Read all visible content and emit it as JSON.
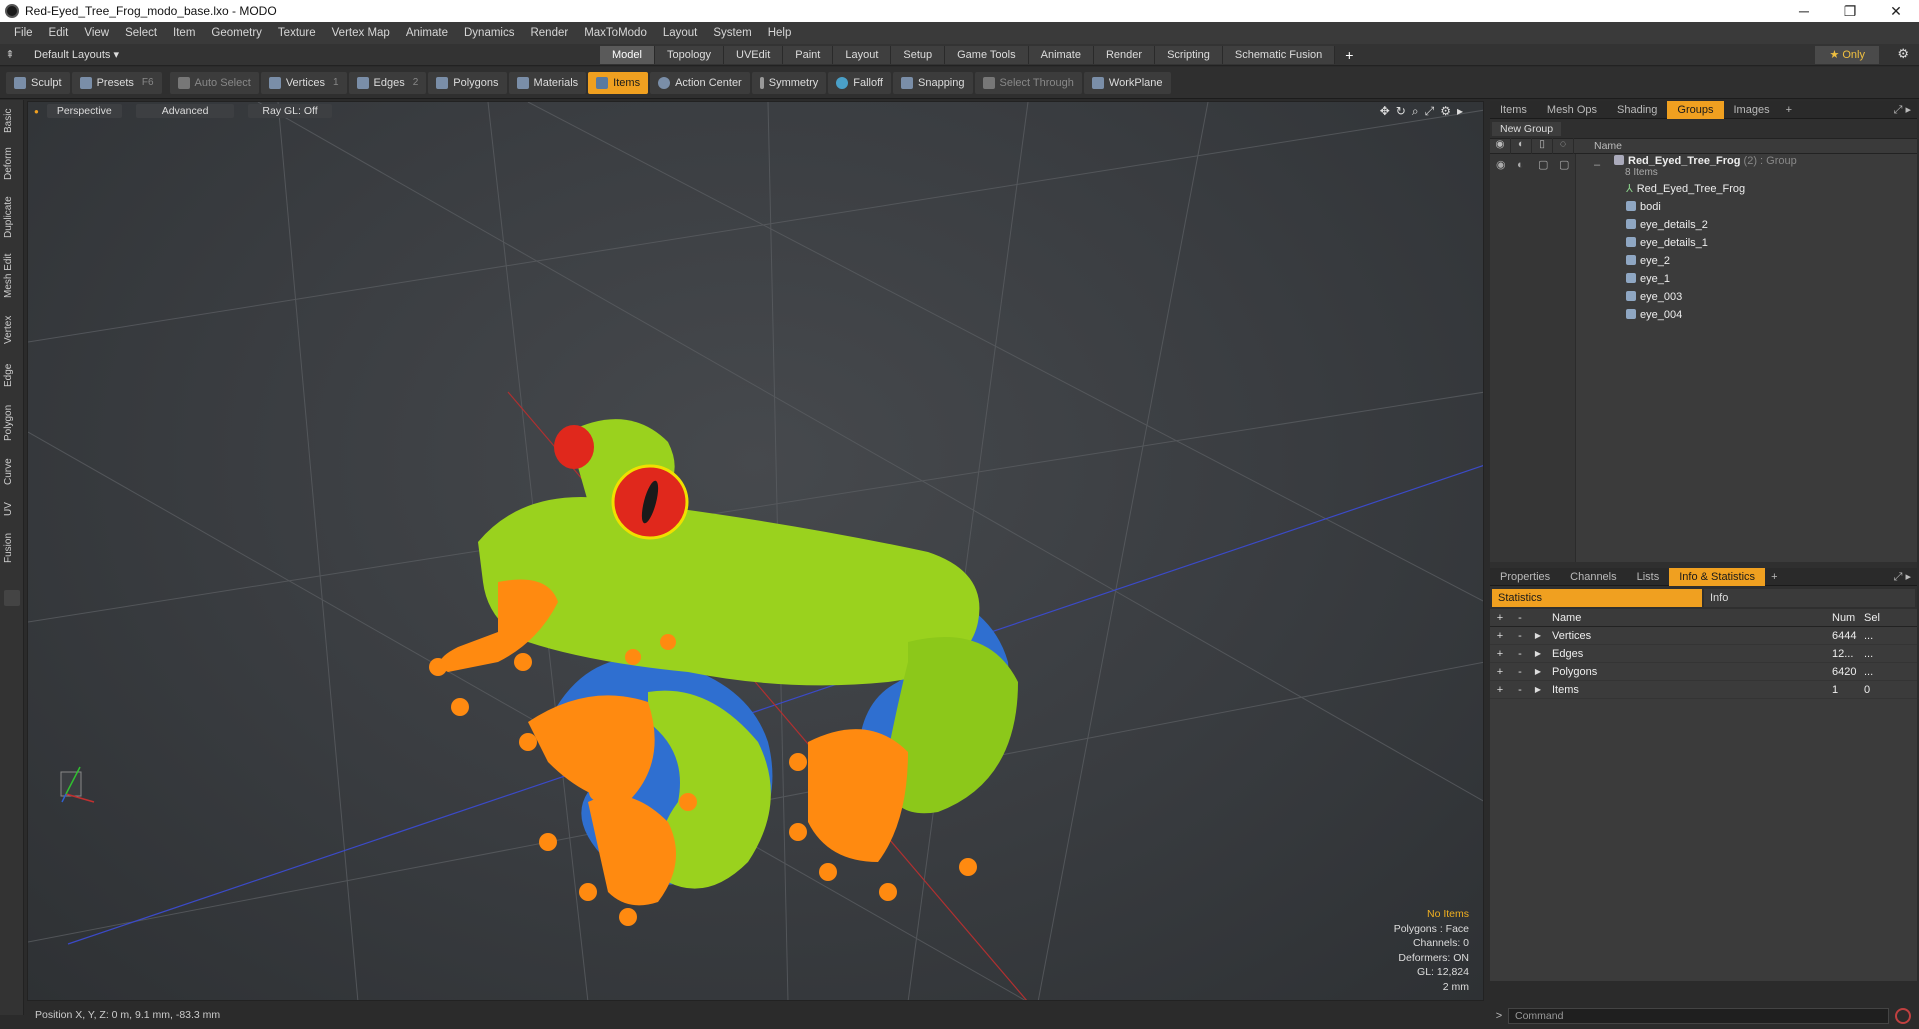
{
  "window": {
    "title": "Red-Eyed_Tree_Frog_modo_base.lxo - MODO",
    "minimize": "─",
    "maximize": "❐",
    "close": "✕"
  },
  "menu": [
    "File",
    "Edit",
    "View",
    "Select",
    "Item",
    "Geometry",
    "Texture",
    "Vertex Map",
    "Animate",
    "Dynamics",
    "Render",
    "MaxToModo",
    "Layout",
    "System",
    "Help"
  ],
  "layoutbar": {
    "layouts_label": "Default Layouts ▾",
    "tabs": [
      "Model",
      "Topology",
      "UVEdit",
      "Paint",
      "Layout",
      "Setup",
      "Game Tools",
      "Animate",
      "Render",
      "Scripting",
      "Schematic Fusion"
    ],
    "active_tab": "Model",
    "add": "+",
    "only_label": "★  Only"
  },
  "toolbar": {
    "sculpt": "Sculpt",
    "presets": "Presets",
    "presets_key": "F6",
    "auto_select": "Auto Select",
    "vertices": "Vertices",
    "vertices_key": "1",
    "edges": "Edges",
    "edges_key": "2",
    "polygons": "Polygons",
    "materials": "Materials",
    "items": "Items",
    "action_center": "Action Center",
    "symmetry": "Symmetry",
    "falloff": "Falloff",
    "snapping": "Snapping",
    "select_through": "Select Through",
    "workplane": "WorkPlane"
  },
  "left_tabs": [
    "Basic",
    "Deform",
    "Duplicate",
    "Mesh Edit",
    "Vertex",
    "Edge",
    "Polygon",
    "Curve",
    "UV",
    "Fusion"
  ],
  "viewport": {
    "view_mode": "Perspective",
    "shading": "Advanced",
    "raygl": "Ray GL: Off",
    "info": {
      "no_items": "No Items",
      "polygons": "Polygons : Face",
      "channels": "Channels: 0",
      "deformers": "Deformers: ON",
      "gl": "GL: 12,824",
      "scale": "2 mm"
    }
  },
  "status": {
    "position": "Position X, Y, Z:   0 m, 9.1 mm, -83.3 mm"
  },
  "top_panel": {
    "tabs": [
      "Items",
      "Mesh Ops",
      "Shading",
      "Groups",
      "Images"
    ],
    "active_tab": "Groups",
    "new_group": "New Group",
    "name_header": "Name",
    "group": {
      "name": "Red_Eyed_Tree_Frog",
      "info": " (2) : Group",
      "count": "8 Items"
    },
    "items": [
      "Red_Eyed_Tree_Frog",
      "bodi",
      "eye_details_2",
      "eye_details_1",
      "eye_2",
      "eye_1",
      "eye_003",
      "eye_004"
    ]
  },
  "bottom_panel": {
    "tabs": [
      "Properties",
      "Channels",
      "Lists",
      "Info & Statistics"
    ],
    "active_tab": "Info & Statistics",
    "statistics_label": "Statistics",
    "info_label": "Info",
    "headers": {
      "name": "Name",
      "num": "Num",
      "sel": "Sel"
    },
    "rows": [
      {
        "name": "Vertices",
        "num": "6444",
        "sel": "..."
      },
      {
        "name": "Edges",
        "num": "12...",
        "sel": "..."
      },
      {
        "name": "Polygons",
        "num": "6420",
        "sel": "..."
      },
      {
        "name": "Items",
        "num": "1",
        "sel": "0"
      }
    ]
  },
  "command": {
    "prompt": ">",
    "placeholder": "Command"
  },
  "colors": {
    "accent": "#f0a020",
    "frog_body": "#9ad21e",
    "frog_feet": "#ff8a10",
    "frog_blue": "#2f6fd0",
    "eye_red": "#e0281c"
  }
}
